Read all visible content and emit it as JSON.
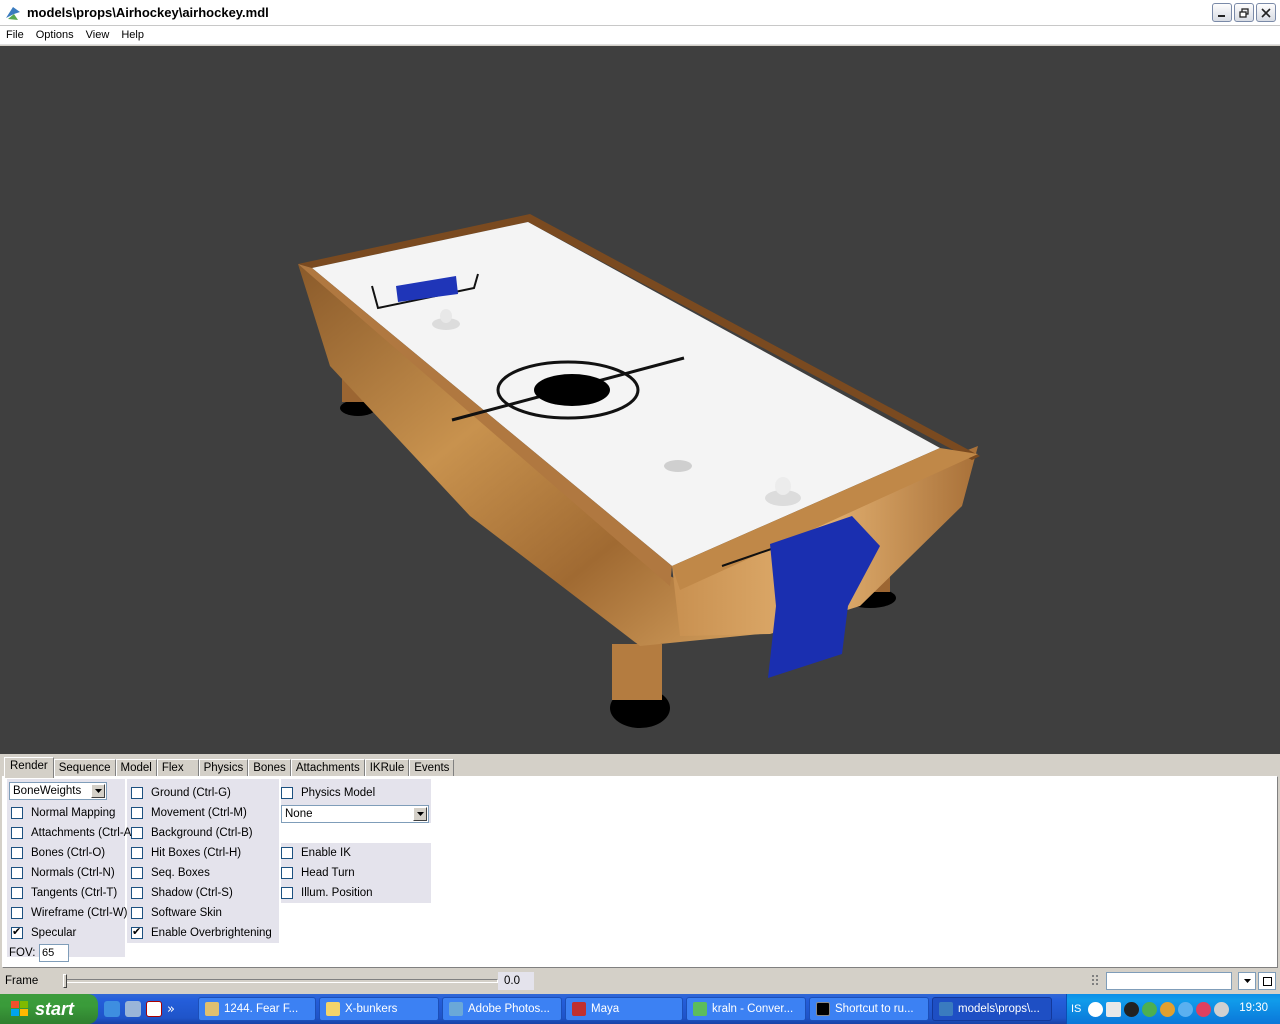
{
  "window": {
    "title": "models\\props\\Airhockey\\airhockey.mdl"
  },
  "menu": [
    "File",
    "Options",
    "View",
    "Help"
  ],
  "tabs": [
    "Render",
    "Sequence",
    "Model",
    "Flex",
    "Physics",
    "Bones",
    "Attachments",
    "IKRule",
    "Events"
  ],
  "render": {
    "mode_select": "BoneWeights",
    "col1": [
      {
        "label": "Normal Mapping",
        "checked": false
      },
      {
        "label": "Attachments (Ctrl-A)",
        "checked": false
      },
      {
        "label": "Bones (Ctrl-O)",
        "checked": false
      },
      {
        "label": "Normals (Ctrl-N)",
        "checked": false
      },
      {
        "label": "Tangents (Ctrl-T)",
        "checked": false
      },
      {
        "label": "Wireframe (Ctrl-W)",
        "checked": false
      },
      {
        "label": "Specular",
        "checked": true
      }
    ],
    "col2": [
      {
        "label": "Ground (Ctrl-G)",
        "checked": false
      },
      {
        "label": "Movement (Ctrl-M)",
        "checked": false
      },
      {
        "label": "Background (Ctrl-B)",
        "checked": false
      },
      {
        "label": "Hit Boxes (Ctrl-H)",
        "checked": false
      },
      {
        "label": "Seq. Boxes",
        "checked": false
      },
      {
        "label": "Shadow (Ctrl-S)",
        "checked": false
      },
      {
        "label": "Software Skin",
        "checked": false
      },
      {
        "label": "Enable Overbrightening",
        "checked": true
      }
    ],
    "col3_top": {
      "label": "Physics Model",
      "checked": false
    },
    "physics_select": "None",
    "col3": [
      {
        "label": "Enable IK",
        "checked": false
      },
      {
        "label": "Head Turn",
        "checked": false
      },
      {
        "label": "Illum. Position",
        "checked": false
      }
    ],
    "fov_label": "FOV:",
    "fov_value": "65"
  },
  "frame": {
    "label": "Frame",
    "value": "0.0",
    "position": 0.0
  },
  "taskbar": {
    "start": "start",
    "tasks": [
      "1244. Fear F...",
      "X-bunkers",
      "Adobe Photos...",
      "Maya",
      "kraln - Conver...",
      "Shortcut to ru...",
      "models\\props\\..."
    ],
    "language": "IS",
    "clock": "19:30"
  }
}
